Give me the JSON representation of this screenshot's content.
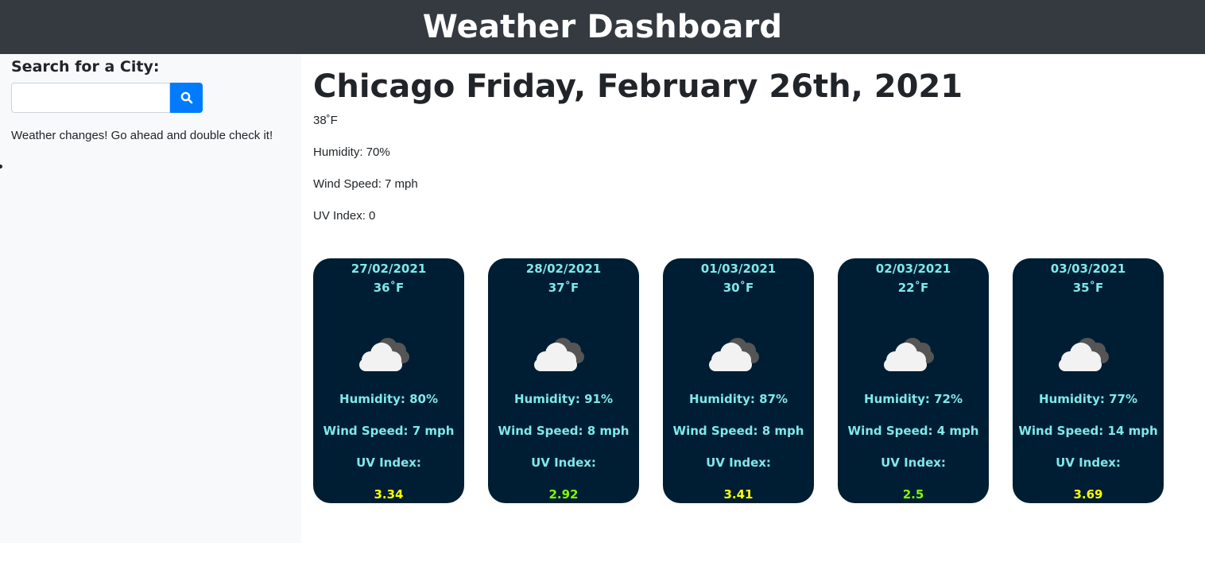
{
  "header": {
    "title": "Weather Dashboard"
  },
  "search": {
    "label": "Search for a City:",
    "value": "",
    "placeholder": "",
    "button_icon": "search-icon",
    "note": "Weather changes! Go ahead and double check it!"
  },
  "current": {
    "title": "Chicago Friday, February 26th, 2021",
    "temp": "38˚F",
    "humidity": "Humidity: 70%",
    "wind": "Wind Speed: 7 mph",
    "uv": "UV Index: 0"
  },
  "forecast": [
    {
      "date": "27/02/2021",
      "temp": "36˚F",
      "icon": "cloudy-icon",
      "humidity": "Humidity: 80%",
      "wind": "Wind Speed: 7 mph",
      "uv_label": "UV Index:",
      "uv_value": "3.34",
      "uv_color": "#ffff00"
    },
    {
      "date": "28/02/2021",
      "temp": "37˚F",
      "icon": "cloudy-icon",
      "humidity": "Humidity: 91%",
      "wind": "Wind Speed: 8 mph",
      "uv_label": "UV Index:",
      "uv_value": "2.92",
      "uv_color": "#7fff00"
    },
    {
      "date": "01/03/2021",
      "temp": "30˚F",
      "icon": "cloudy-icon",
      "humidity": "Humidity: 87%",
      "wind": "Wind Speed: 8 mph",
      "uv_label": "UV Index:",
      "uv_value": "3.41",
      "uv_color": "#ffff00"
    },
    {
      "date": "02/03/2021",
      "temp": "22˚F",
      "icon": "cloudy-icon",
      "humidity": "Humidity: 72%",
      "wind": "Wind Speed: 4 mph",
      "uv_label": "UV Index:",
      "uv_value": "2.5",
      "uv_color": "#7fff00"
    },
    {
      "date": "03/03/2021",
      "temp": "35˚F",
      "icon": "cloudy-icon",
      "humidity": "Humidity: 77%",
      "wind": "Wind Speed: 14 mph",
      "uv_label": "UV Index:",
      "uv_value": "3.69",
      "uv_color": "#ffff00"
    }
  ],
  "colors": {
    "header_bg": "#343a40",
    "sidebar_bg": "#f8f9fa",
    "card_bg": "#001e33",
    "card_text": "#7fe8ea",
    "button": "#007bff"
  }
}
